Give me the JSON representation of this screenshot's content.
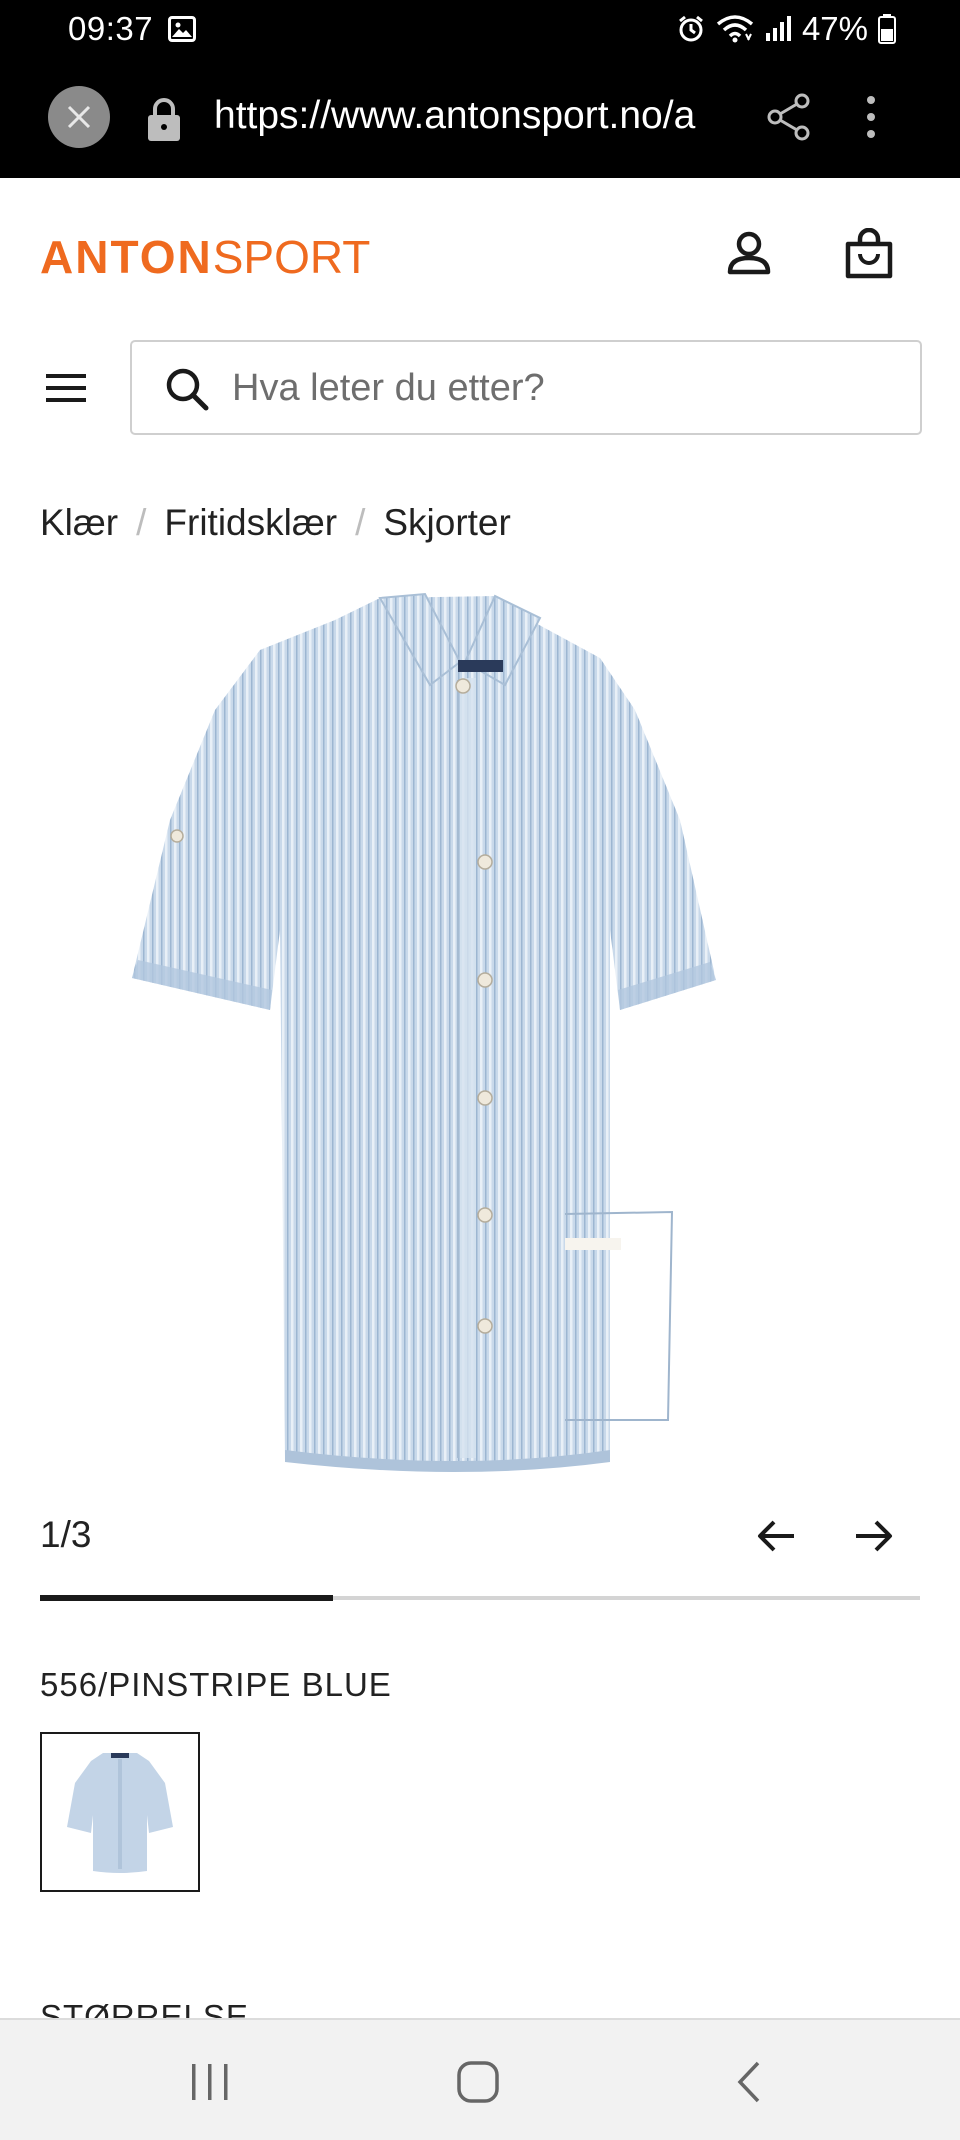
{
  "status": {
    "time": "09:37",
    "battery": "47%",
    "icons": [
      "gallery-icon",
      "alarm-icon",
      "wifi-icon",
      "signal-icon",
      "battery-icon"
    ]
  },
  "browser": {
    "url": "https://www.antonsport.no/a",
    "icons": [
      "close-icon",
      "lock-icon",
      "share-icon",
      "more-vertical-icon"
    ]
  },
  "header": {
    "logo_part1": "ANTON",
    "logo_part2": "SPORT",
    "brand_color": "#ef6a1f",
    "icons": [
      "account-icon",
      "shopping-bag-icon",
      "menu-icon"
    ]
  },
  "search": {
    "placeholder": "Hva leter du etter?"
  },
  "breadcrumb": {
    "items": [
      "Klær",
      "Fritidsklær",
      "Skjorter"
    ],
    "separator": "/"
  },
  "gallery": {
    "counter": "1/3",
    "progress_fraction": 0.333
  },
  "product": {
    "color_label": "556/PINSTRIPE BLUE",
    "size_label": "STØRRELSE"
  }
}
